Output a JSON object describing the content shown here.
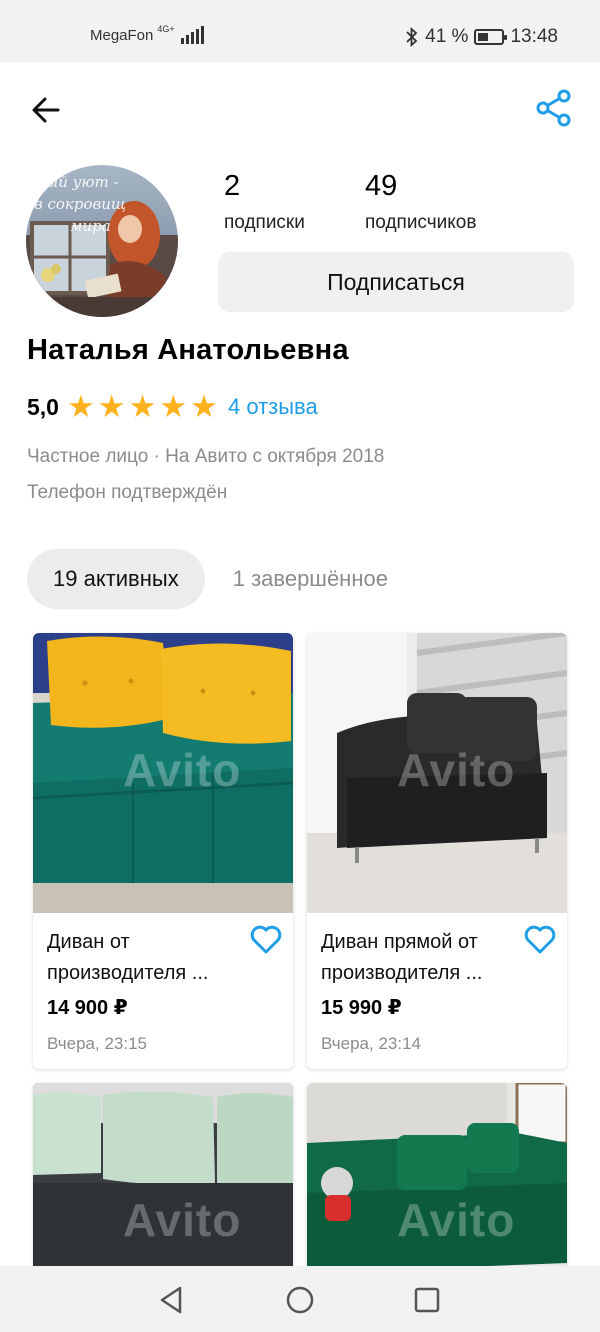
{
  "status_bar": {
    "carrier": "MegaFon",
    "network": "4G+",
    "battery": "41 %",
    "time": "13:48"
  },
  "toolbar": {
    "back_icon": "arrow-left-icon",
    "share_icon": "share-icon",
    "accent": "#1f9ee7"
  },
  "profile": {
    "avatar_caption_1": "ый уют -",
    "avatar_caption_2": "в сокровищ",
    "avatar_caption_3": "мира",
    "subscriptions_count": "2",
    "subscriptions_label": "подписки",
    "subscribers_count": "49",
    "subscribers_label": "подписчиков",
    "subscribe_label": "Подписаться",
    "name": "Наталья Анатольевна",
    "rating": "5,0",
    "stars": 5,
    "reviews_link": "4 отзыва",
    "meta": "Частное лицо · На Авито с октября 2018",
    "phone": "Телефон подтверждён"
  },
  "tabs": {
    "active": "19 активных",
    "completed": "1 завершённое"
  },
  "listings": [
    {
      "title": "Диван от производителя ...",
      "price": "14 900 ₽",
      "date": "Вчера, 23:15",
      "watermark": "Avito"
    },
    {
      "title": "Диван прямой от производителя ...",
      "price": "15 990 ₽",
      "date": "Вчера, 23:14",
      "watermark": "Avito"
    },
    {
      "watermark": "Avito"
    },
    {
      "watermark": "Avito"
    }
  ]
}
